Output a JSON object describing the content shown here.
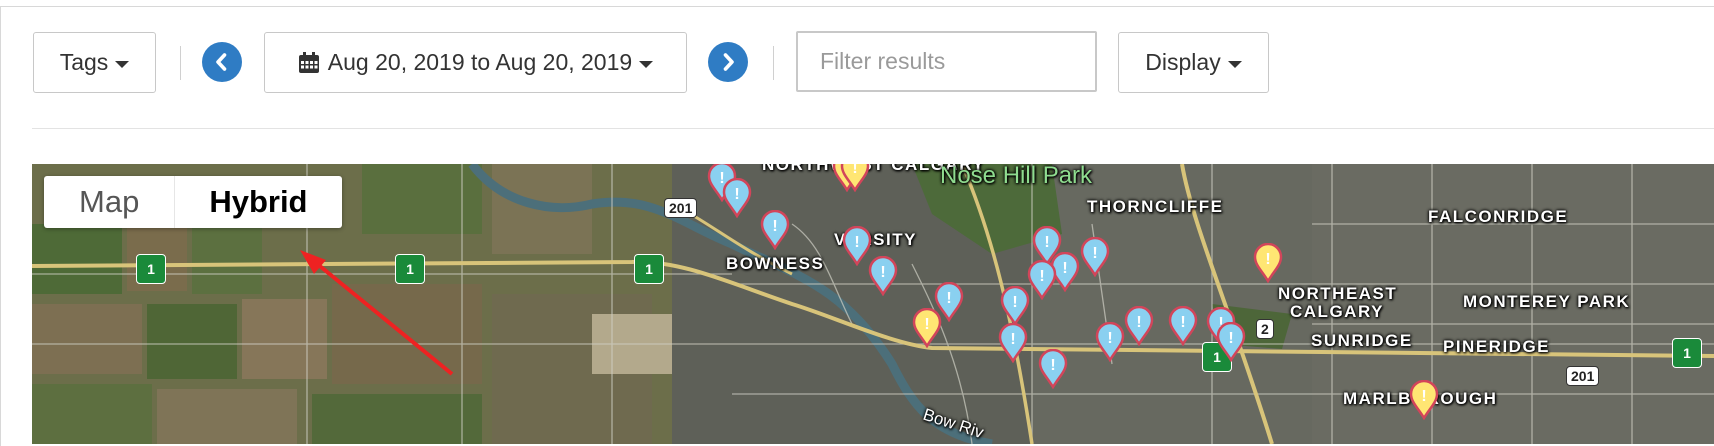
{
  "toolbar": {
    "tags_label": "Tags",
    "date_range": "Aug 20, 2019 to Aug 20, 2019",
    "filter_placeholder": "Filter results",
    "display_label": "Display"
  },
  "map": {
    "type_options": [
      "Map",
      "Hybrid"
    ],
    "selected_type": "Hybrid",
    "labels": {
      "northwest_calgary": "NORTHWEST CALGARY",
      "nose_hill_park": "Nose Hill Park",
      "thorncliffe": "THORNCLIFFE",
      "falconridge": "FALCONRIDGE",
      "varsity": "VARSITY",
      "bowness": "BOWNESS",
      "northeast": "NORTHEAST",
      "calgary": "CALGARY",
      "monterey_park": "MONTEREY PARK",
      "sunridge": "SUNRIDGE",
      "pineridge": "PINERIDGE",
      "marlborough": "MARLBOROUGH",
      "bow_river": "Bow Riv"
    },
    "route_numbers": [
      "1",
      "201",
      "2"
    ],
    "alert_glyph": "!"
  },
  "colors": {
    "accent_blue": "#2f7cc4",
    "pin_blue": "#8ad0f0",
    "pin_yellow": "#ffe673",
    "pin_border": "#d2455a",
    "annotation_arrow": "#ee2222"
  }
}
